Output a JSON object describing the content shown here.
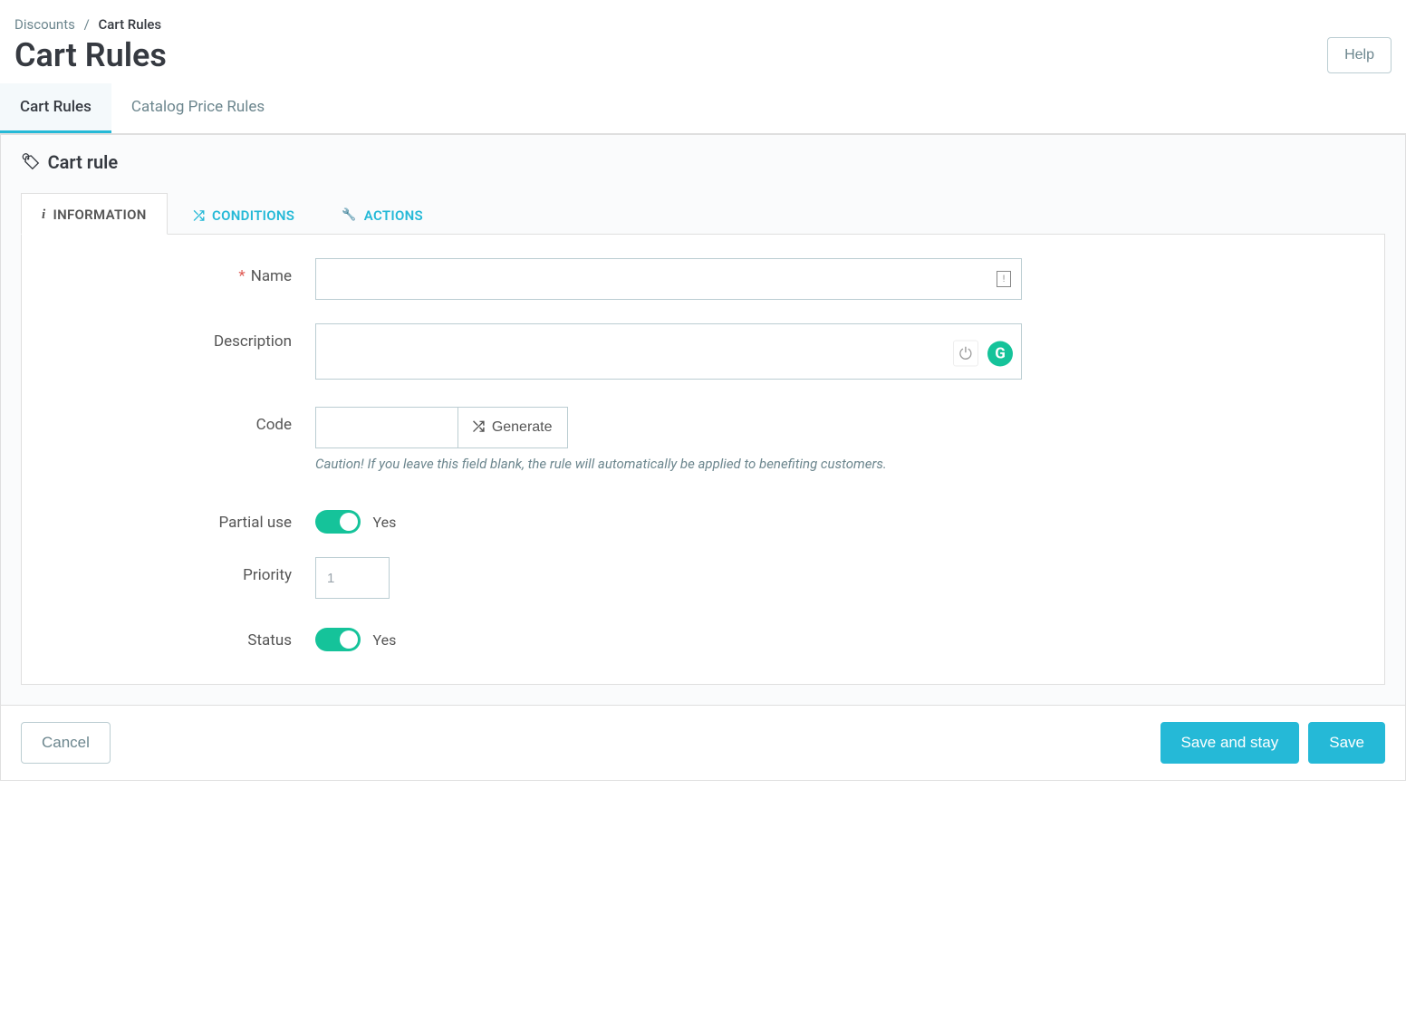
{
  "breadcrumb": {
    "parent": "Discounts",
    "sep": "/",
    "current": "Cart Rules"
  },
  "page_title": "Cart Rules",
  "help_label": "Help",
  "top_tabs": {
    "cart_rules": "Cart Rules",
    "catalog_price_rules": "Catalog Price Rules"
  },
  "panel_title": "Cart rule",
  "inner_tabs": {
    "information": "INFORMATION",
    "conditions": "CONDITIONS",
    "actions": "ACTIONS"
  },
  "form": {
    "name_label": "Name",
    "name_value": "",
    "description_label": "Description",
    "description_value": "",
    "code_label": "Code",
    "code_value": "",
    "generate_label": "Generate",
    "code_help": "Caution! If you leave this field blank, the rule will automatically be applied to benefiting customers.",
    "partial_use_label": "Partial use",
    "partial_use_state": "Yes",
    "priority_label": "Priority",
    "priority_value": "1",
    "status_label": "Status",
    "status_state": "Yes"
  },
  "footer": {
    "cancel": "Cancel",
    "save_and_stay": "Save and stay",
    "save": "Save"
  },
  "icons": {
    "info_glyph": "i",
    "shuffle_glyph": "⤮",
    "wrench_glyph": "🔧",
    "tag_glyph": "🏷",
    "power_glyph": "⏻",
    "grammarly_glyph": "G",
    "flag_glyph": "!"
  }
}
